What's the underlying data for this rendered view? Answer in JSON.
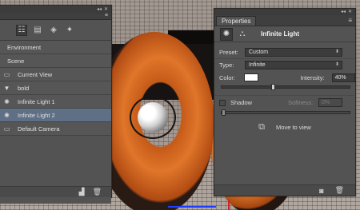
{
  "window_controls": {
    "collapse": "◂◂",
    "close": "✕"
  },
  "layers_panel": {
    "menu_icon": "≡",
    "toolbar_icons": [
      "scene-filter-icon",
      "mesh-filter-icon",
      "material-filter-icon",
      "light-filter-icon"
    ],
    "rows": [
      {
        "label": "Environment",
        "icon": "",
        "selected": false
      },
      {
        "label": "Scene",
        "icon": "",
        "selected": false
      },
      {
        "label": "Current View",
        "icon": "camera-icon",
        "selected": false
      },
      {
        "label": "bold",
        "icon": "mesh-icon",
        "selected": false
      },
      {
        "label": "Infinite Light 1",
        "icon": "infinite-light-icon",
        "selected": false
      },
      {
        "label": "Infinite Light 2",
        "icon": "infinite-light-icon",
        "selected": true
      },
      {
        "label": "Default Camera",
        "icon": "camera-icon",
        "selected": false
      }
    ],
    "bottom_icons": [
      "new-light-icon",
      "delete-icon"
    ]
  },
  "properties_panel": {
    "tab_label": "Properties",
    "menu_icon": "≡",
    "title": "Infinite Light",
    "preset": {
      "label": "Preset:",
      "value": "Custom"
    },
    "type": {
      "label": "Type:",
      "value": "Infinite"
    },
    "color": {
      "label": "Color:",
      "value": "#ffffff"
    },
    "intensity": {
      "label": "Intensity:",
      "value": "40%",
      "fraction": 0.4
    },
    "shadow": {
      "label": "Shadow",
      "checked": false
    },
    "softness": {
      "label": "Softness:",
      "value": "0%",
      "fraction": 0.0
    },
    "move_to_view": "Move to view",
    "bottom_icons": [
      "reset-icon",
      "delete-icon"
    ]
  }
}
